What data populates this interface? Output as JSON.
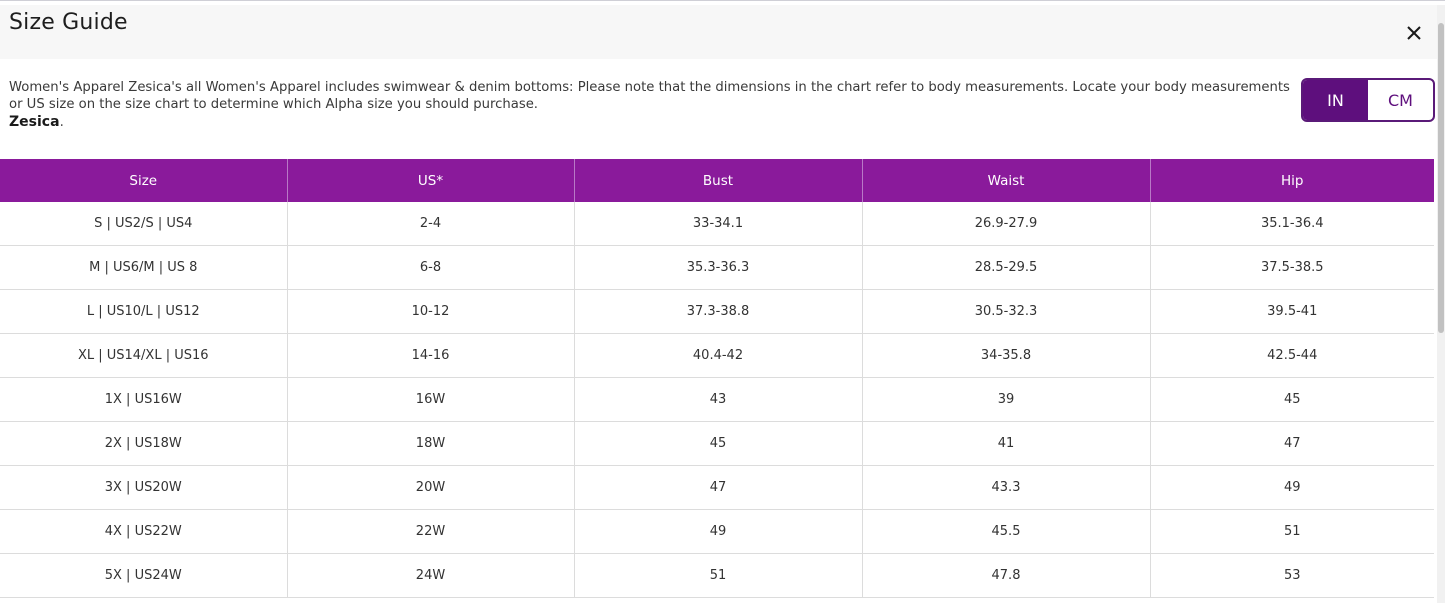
{
  "modal": {
    "title": "Size Guide",
    "close_icon": "close-icon",
    "description": "Women's Apparel Zesica's all Women's Apparel includes swimwear & denim bottoms: Please note that the dimensions in the chart refer to body measurements. Locate your body measurements or US size on the size chart to determine which Alpha size you should purchase.",
    "brand": "Zesica",
    "brand_suffix": "."
  },
  "unit_toggle": {
    "in_label": "IN",
    "cm_label": "CM",
    "selected": "IN"
  },
  "colors": {
    "header_purple": "#8a1a9b",
    "toggle_purple": "#5e0f7d"
  },
  "table": {
    "headers": [
      "Size",
      "US*",
      "Bust",
      "Waist",
      "Hip"
    ],
    "rows": [
      [
        "S | US2/S | US4",
        "2-4",
        "33-34.1",
        "26.9-27.9",
        "35.1-36.4"
      ],
      [
        "M | US6/M | US 8",
        "6-8",
        "35.3-36.3",
        "28.5-29.5",
        "37.5-38.5"
      ],
      [
        "L | US10/L | US12",
        "10-12",
        "37.3-38.8",
        "30.5-32.3",
        "39.5-41"
      ],
      [
        "XL | US14/XL | US16",
        "14-16",
        "40.4-42",
        "34-35.8",
        "42.5-44"
      ],
      [
        "1X | US16W",
        "16W",
        "43",
        "39",
        "45"
      ],
      [
        "2X | US18W",
        "18W",
        "45",
        "41",
        "47"
      ],
      [
        "3X | US20W",
        "20W",
        "47",
        "43.3",
        "49"
      ],
      [
        "4X | US22W",
        "22W",
        "49",
        "45.5",
        "51"
      ],
      [
        "5X | US24W",
        "24W",
        "51",
        "47.8",
        "53"
      ]
    ]
  }
}
